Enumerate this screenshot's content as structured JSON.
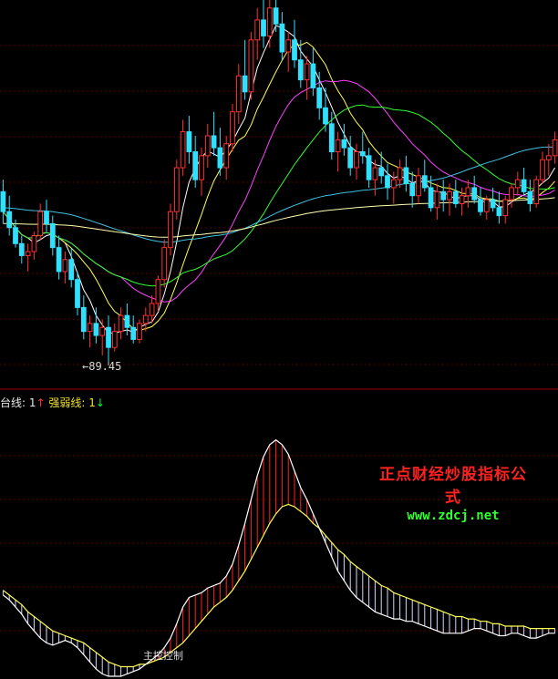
{
  "indicator_bar": {
    "label1": "台线:",
    "value1": "1",
    "arrow1": "↑",
    "label2": "强弱线:",
    "value2": "1",
    "arrow2": "↓"
  },
  "watermark": {
    "line1": "正点财经炒股指标公式",
    "line2": "www.zdcj.net"
  },
  "annotation": {
    "main_control": "主控控制"
  },
  "colors": {
    "up": "#ff3030",
    "down": "#30e0ff",
    "grid": "#5a0000",
    "ma5": "#ffffff",
    "ma10": "#ffff50",
    "ma20": "#ff40ff",
    "ma30": "#30ff30",
    "ma60": "#40c0e0",
    "ma120": "#ffffb0",
    "osc_fast": "#ffffff",
    "osc_slow": "#ffff50",
    "hatch_up": "#ff2020",
    "hatch_down": "#d8d8ff"
  },
  "chart_data": [
    {
      "type": "candlestick",
      "title": "",
      "low_marker": {
        "label": "89.45",
        "value": 89.45,
        "index": 17
      },
      "ylim": [
        83,
        180
      ],
      "candles": [
        [
          132,
          135,
          124,
          127
        ],
        [
          127,
          131,
          121,
          123
        ],
        [
          123,
          125,
          118,
          119
        ],
        [
          119,
          121,
          114,
          116
        ],
        [
          116,
          119,
          112,
          117
        ],
        [
          117,
          122,
          115,
          121
        ],
        [
          121,
          129,
          120,
          127
        ],
        [
          127,
          130,
          122,
          124
        ],
        [
          124,
          126,
          116,
          118
        ],
        [
          118,
          121,
          110,
          112
        ],
        [
          112,
          117,
          109,
          115
        ],
        [
          115,
          118,
          108,
          110
        ],
        [
          110,
          112,
          101,
          103
        ],
        [
          103,
          106,
          95,
          97
        ],
        [
          97,
          101,
          93,
          99
        ],
        [
          99,
          103,
          94,
          96
        ],
        [
          96,
          100,
          91,
          98
        ],
        [
          98,
          101,
          89.45,
          93
        ],
        [
          93,
          99,
          92,
          97
        ],
        [
          97,
          103,
          95,
          101
        ],
        [
          101,
          104,
          96,
          98
        ],
        [
          98,
          101,
          94,
          95
        ],
        [
          95,
          100,
          94,
          99
        ],
        [
          99,
          103,
          97,
          101
        ],
        [
          101,
          106,
          99,
          104
        ],
        [
          104,
          111,
          102,
          110
        ],
        [
          110,
          120,
          108,
          118
        ],
        [
          118,
          129,
          116,
          127
        ],
        [
          127,
          140,
          125,
          138
        ],
        [
          138,
          150,
          136,
          147
        ],
        [
          147,
          151,
          139,
          142
        ],
        [
          142,
          146,
          133,
          135
        ],
        [
          135,
          143,
          131,
          141
        ],
        [
          141,
          149,
          138,
          146
        ],
        [
          146,
          152,
          141,
          143
        ],
        [
          143,
          148,
          136,
          138
        ],
        [
          138,
          146,
          135,
          144
        ],
        [
          144,
          154,
          142,
          152
        ],
        [
          152,
          164,
          149,
          161
        ],
        [
          161,
          170,
          155,
          157
        ],
        [
          157,
          172,
          155,
          170
        ],
        [
          170,
          178,
          165,
          175
        ],
        [
          175,
          180,
          168,
          171
        ],
        [
          171,
          180,
          168,
          178
        ],
        [
          178,
          181,
          172,
          174
        ],
        [
          174,
          177,
          165,
          167
        ],
        [
          167,
          172,
          162,
          170
        ],
        [
          170,
          175,
          163,
          165
        ],
        [
          165,
          170,
          158,
          160
        ],
        [
          160,
          166,
          155,
          164
        ],
        [
          164,
          168,
          156,
          158
        ],
        [
          158,
          162,
          150,
          153
        ],
        [
          153,
          158,
          147,
          149
        ],
        [
          149,
          152,
          140,
          142
        ],
        [
          142,
          147,
          137,
          145
        ],
        [
          145,
          149,
          141,
          143
        ],
        [
          143,
          146,
          136,
          138
        ],
        [
          138,
          144,
          135,
          142
        ],
        [
          142,
          147,
          139,
          141
        ],
        [
          141,
          143,
          133,
          135
        ],
        [
          135,
          140,
          131,
          138
        ],
        [
          138,
          142,
          134,
          136
        ],
        [
          136,
          139,
          130,
          133
        ],
        [
          133,
          137,
          129,
          135
        ],
        [
          135,
          140,
          133,
          138
        ],
        [
          138,
          141,
          132,
          134
        ],
        [
          134,
          137,
          128,
          131
        ],
        [
          131,
          138,
          129,
          136
        ],
        [
          136,
          140,
          132,
          133
        ],
        [
          133,
          136,
          127,
          128
        ],
        [
          128,
          134,
          125,
          132
        ],
        [
          132,
          135,
          127,
          130
        ],
        [
          130,
          134,
          126,
          132
        ],
        [
          132,
          135,
          128,
          129
        ],
        [
          129,
          133,
          126,
          131
        ],
        [
          131,
          135,
          128,
          133
        ],
        [
          133,
          136,
          129,
          130
        ],
        [
          130,
          133,
          126,
          127
        ],
        [
          127,
          131,
          125,
          130
        ],
        [
          130,
          133,
          127,
          128
        ],
        [
          128,
          132,
          124,
          126
        ],
        [
          126,
          131,
          124,
          130
        ],
        [
          130,
          134,
          128,
          133
        ],
        [
          133,
          137,
          131,
          135
        ],
        [
          135,
          138,
          131,
          132
        ],
        [
          132,
          135,
          127,
          129
        ],
        [
          129,
          136,
          128,
          135
        ],
        [
          135,
          142,
          134,
          140
        ],
        [
          140,
          144,
          136,
          141
        ],
        [
          141,
          147,
          139,
          145
        ]
      ],
      "ma_periods": [
        5,
        10,
        20,
        30,
        60,
        120
      ]
    },
    {
      "type": "line",
      "title": "",
      "ylim": [
        0,
        100
      ],
      "series": [
        {
          "values": [
            34,
            32,
            29,
            26,
            22,
            19,
            16,
            14,
            13,
            14,
            15,
            14,
            12,
            9,
            6,
            3,
            1,
            0,
            0,
            0,
            1,
            2,
            3,
            5,
            7,
            9,
            12,
            16,
            22,
            29,
            33,
            34,
            35,
            37,
            38,
            39,
            42,
            47,
            55,
            64,
            74,
            84,
            92,
            97,
            99,
            97,
            93,
            86,
            79,
            74,
            68,
            62,
            56,
            50,
            44,
            40,
            36,
            33,
            31,
            29,
            27,
            26,
            25,
            24,
            24,
            23,
            23,
            22,
            21,
            20,
            19,
            18,
            18,
            18,
            18,
            19,
            20,
            20,
            19,
            18,
            17,
            17,
            18,
            18,
            17,
            16,
            16,
            17,
            18,
            18
          ]
        },
        {
          "values": [
            36,
            34,
            32,
            30,
            27,
            25,
            23,
            21,
            19,
            18,
            17,
            16,
            15,
            14,
            12,
            10,
            8,
            6,
            5,
            4,
            4,
            4,
            5,
            5,
            6,
            7,
            8,
            10,
            12,
            14,
            17,
            20,
            23,
            26,
            29,
            31,
            33,
            36,
            40,
            44,
            49,
            54,
            59,
            64,
            68,
            71,
            72,
            71,
            69,
            67,
            64,
            62,
            59,
            56,
            53,
            51,
            48,
            46,
            44,
            42,
            40,
            38,
            37,
            35,
            34,
            33,
            32,
            31,
            30,
            29,
            28,
            27,
            26,
            25,
            25,
            24,
            24,
            23,
            23,
            22,
            22,
            21,
            21,
            21,
            21,
            20,
            20,
            20,
            20,
            20
          ]
        }
      ]
    }
  ]
}
